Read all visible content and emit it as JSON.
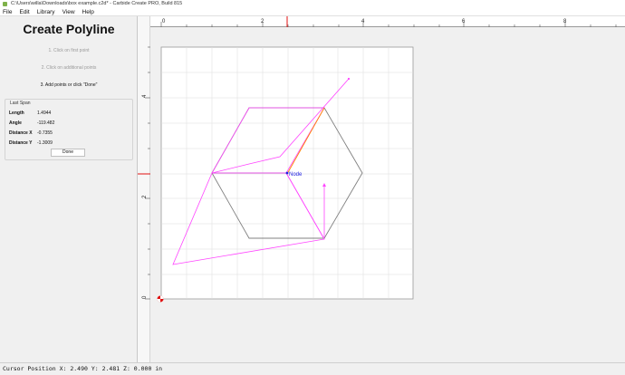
{
  "window": {
    "title": "C:\\Users\\willa\\Downloads\\box example.c2d* - Carbide Create PRO, Build 815"
  },
  "menu": [
    "File",
    "Edit",
    "Library",
    "View",
    "Help"
  ],
  "panel": {
    "title": "Create Polyline",
    "steps": [
      "1. Click on first point",
      "2. Click on additional points",
      "3. Add points or click \"Done\""
    ],
    "last_span": {
      "title": "Last Span",
      "rows": [
        {
          "label": "Length",
          "value": "1.4944"
        },
        {
          "label": "Angle",
          "value": "-119.482"
        },
        {
          "label": "Distance X",
          "value": "-0.7355"
        },
        {
          "label": "Distance Y",
          "value": "-1.3009"
        }
      ]
    },
    "done_label": "Done"
  },
  "ruler": {
    "top_labels": [
      "0",
      "2",
      "4",
      "6",
      "8"
    ],
    "left_labels": [
      "4",
      "2",
      "0"
    ]
  },
  "canvas": {
    "node_label": "Node"
  },
  "status": "Cursor Position X: 2.490 Y: 2.481 Z: 0.000 in",
  "colors": {
    "polyline": "#ff44ff",
    "hexagon": "#808080",
    "highlight": "#ff8800",
    "node": "#2020e0",
    "marker": "#e01010"
  }
}
